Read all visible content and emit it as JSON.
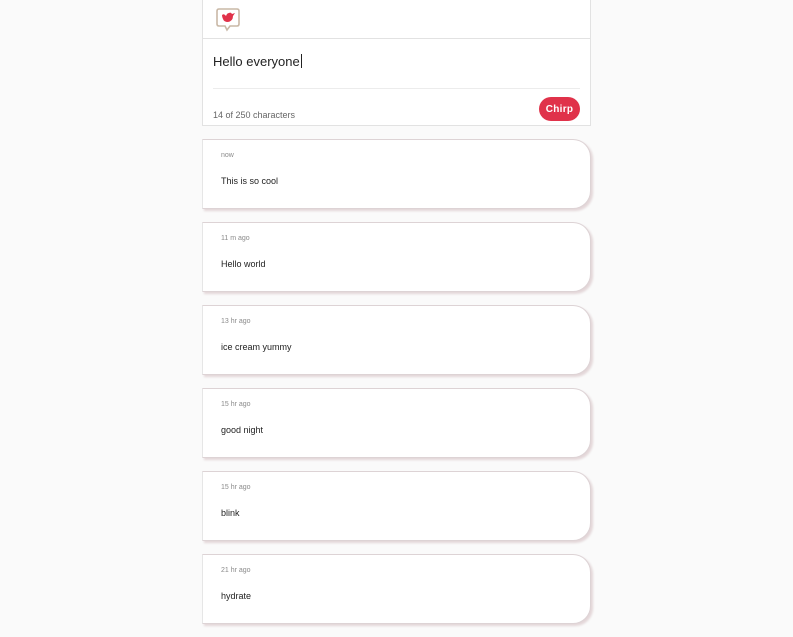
{
  "composer": {
    "logo_icon": "bird-speech-bubble-icon",
    "input_value": "Hello everyone",
    "counter_text": "14 of 250 characters",
    "button_label": "Chirp",
    "accent_color": "#e0324a"
  },
  "feed": {
    "posts": [
      {
        "time": "now",
        "text": "This is so cool"
      },
      {
        "time": "11 m ago",
        "text": "Hello world"
      },
      {
        "time": "13 hr ago",
        "text": "ice cream yummy"
      },
      {
        "time": "15 hr ago",
        "text": "good night"
      },
      {
        "time": "15 hr ago",
        "text": "blink"
      },
      {
        "time": "21 hr ago",
        "text": "hydrate"
      }
    ]
  }
}
